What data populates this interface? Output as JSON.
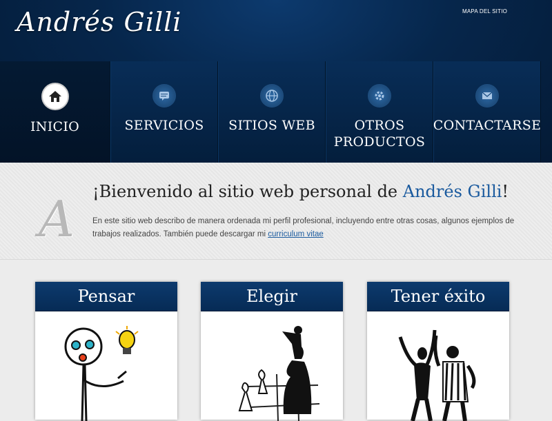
{
  "header": {
    "logo": "Andrés Gilli",
    "sitemap_label": "MAPA DEL SITIO"
  },
  "nav": {
    "items": [
      {
        "label": "INICIO",
        "icon": "home-icon",
        "active": true
      },
      {
        "label": "SERVICIOS",
        "icon": "chat-icon",
        "active": false
      },
      {
        "label": "SITIOS WEB",
        "icon": "globe-icon",
        "active": false
      },
      {
        "label": "OTROS PRODUCTOS",
        "icon": "gear-icon",
        "active": false
      },
      {
        "label": "CONTACTARSE",
        "icon": "mail-icon",
        "active": false
      }
    ]
  },
  "welcome": {
    "initial": "A",
    "title_prefix": "¡Bienvenido al sitio web personal de ",
    "title_name": "Andrés Gilli",
    "title_suffix": "!",
    "text_prefix": "En este sitio web describo de manera ordenada mi perfil profesional, incluyendo entre otras cosas, algunos ejemplos de trabajos realizados. También puede descargar mi ",
    "link": "curriculum vitae"
  },
  "cards": [
    {
      "title": "Pensar",
      "image": "thinking-figure-illustration"
    },
    {
      "title": "Elegir",
      "image": "chess-pieces-illustration"
    },
    {
      "title": "Tener éxito",
      "image": "celebrating-figures-illustration"
    }
  ]
}
